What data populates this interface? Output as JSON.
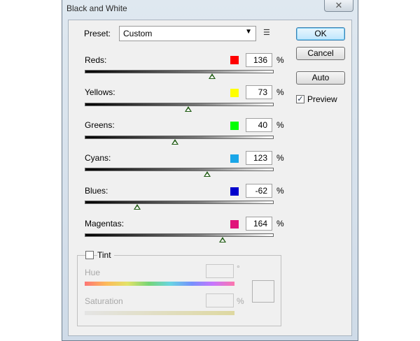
{
  "window": {
    "title": "Black and White",
    "close_glyph": "✕"
  },
  "preset": {
    "label": "Preset:",
    "value": "Custom",
    "dropdown_arrow": "▼",
    "menu_icon": "☰"
  },
  "buttons": {
    "ok": "OK",
    "cancel": "Cancel",
    "auto": "Auto"
  },
  "preview": {
    "label": "Preview",
    "checked": true,
    "check_glyph": "✓"
  },
  "sliders": [
    {
      "label": "Reds:",
      "value": "136",
      "unit": "%",
      "color": "#ff0000"
    },
    {
      "label": "Yellows:",
      "value": "73",
      "unit": "%",
      "color": "#ffff00"
    },
    {
      "label": "Greens:",
      "value": "40",
      "unit": "%",
      "color": "#00ff00"
    },
    {
      "label": "Cyans:",
      "value": "123",
      "unit": "%",
      "color": "#1aa6e8"
    },
    {
      "label": "Blues:",
      "value": "-62",
      "unit": "%",
      "color": "#0000cc"
    },
    {
      "label": "Magentas:",
      "value": "164",
      "unit": "%",
      "color": "#e0147a"
    }
  ],
  "tint": {
    "label": "Tint",
    "checked": false,
    "hue_label": "Hue",
    "hue_unit": "°",
    "saturation_label": "Saturation",
    "saturation_unit": "%"
  }
}
